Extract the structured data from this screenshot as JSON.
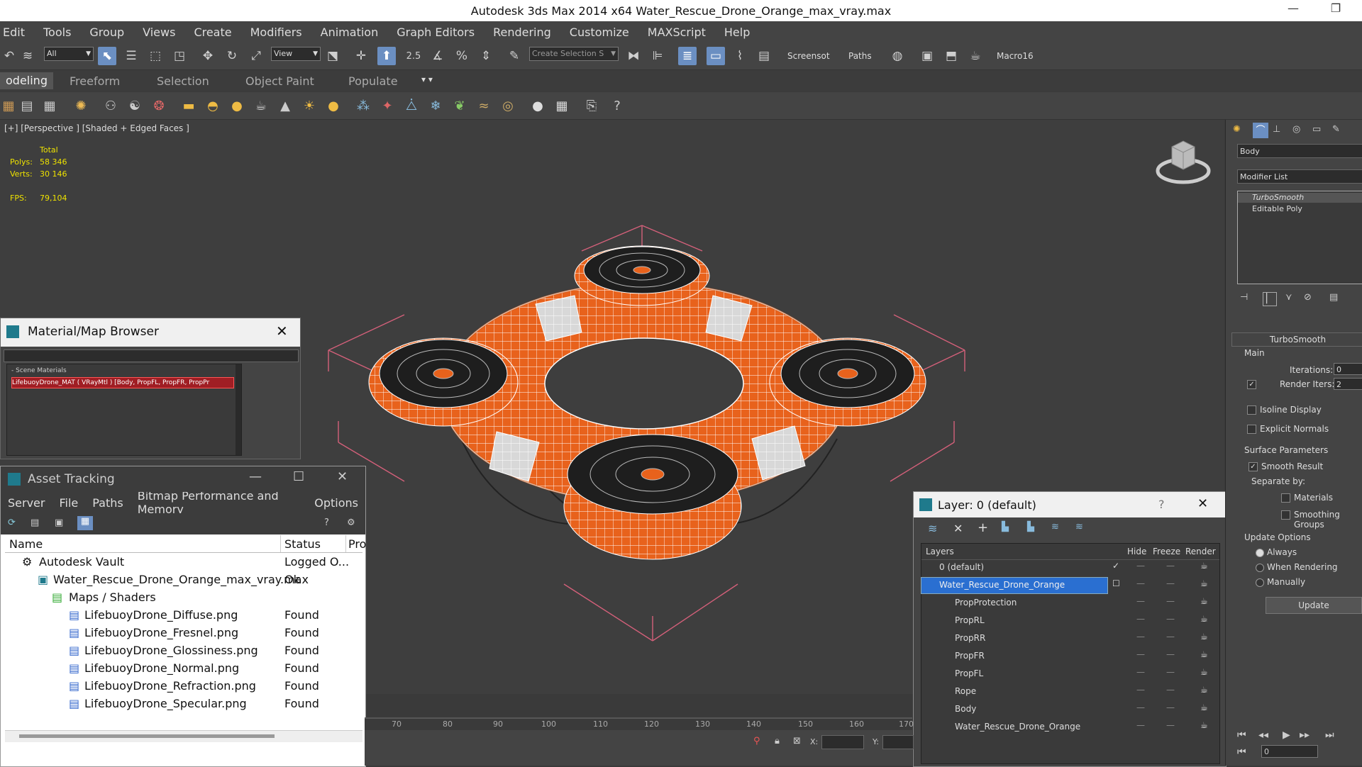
{
  "window": {
    "title": "Autodesk 3ds Max  2014 x64    Water_Rescue_Drone_Orange_max_vray.max"
  },
  "menu": [
    "Edit",
    "Tools",
    "Group",
    "Views",
    "Create",
    "Modifiers",
    "Animation",
    "Graph Editors",
    "Rendering",
    "Customize",
    "MAXScript",
    "Help"
  ],
  "toolbar": {
    "filter_value": "All",
    "coord_value": "View",
    "selection_set_placeholder": "Create Selection S",
    "screenshot_label": "Screensot",
    "paths_label": "Paths",
    "macro_label": "Macro16",
    "snap_angle_label": "2.5"
  },
  "ribbon": {
    "tabs": [
      "odeling",
      "Freeform",
      "Selection",
      "Object Paint",
      "Populate"
    ]
  },
  "viewport": {
    "label": "[+] [Perspective ] [Shaded + Edged Faces ]",
    "stats": {
      "total_label": "Total",
      "polys_label": "Polys:",
      "polys_value": "58 346",
      "verts_label": "Verts:",
      "verts_value": "30 146",
      "fps_label": "FPS:",
      "fps_value": "79,104"
    },
    "colors": {
      "drone_orange": "#e8621c",
      "bounding_box": "#d4607a",
      "selection_wire": "#ffffff"
    }
  },
  "material_browser": {
    "title": "Material/Map Browser",
    "section": "- Scene Materials",
    "item": "LifebuoyDrone_MAT ( VRayMtl ) [Body, PropFL, PropFR, PropPr"
  },
  "asset_tracking": {
    "title": "Asset Tracking",
    "menu": [
      "Server",
      "File",
      "Paths",
      "Bitmap Performance and Memory",
      "Options"
    ],
    "columns": [
      "Name",
      "Status",
      "Pro"
    ],
    "rows": [
      {
        "name": "Autodesk Vault",
        "status": "Logged O..."
      },
      {
        "name": "Water_Rescue_Drone_Orange_max_vray.max",
        "status": "Ok"
      },
      {
        "name": "Maps / Shaders",
        "status": ""
      },
      {
        "name": "LifebuoyDrone_Diffuse.png",
        "status": "Found"
      },
      {
        "name": "LifebuoyDrone_Fresnel.png",
        "status": "Found"
      },
      {
        "name": "LifebuoyDrone_Glossiness.png",
        "status": "Found"
      },
      {
        "name": "LifebuoyDrone_Normal.png",
        "status": "Found"
      },
      {
        "name": "LifebuoyDrone_Refraction.png",
        "status": "Found"
      },
      {
        "name": "LifebuoyDrone_Specular.png",
        "status": "Found"
      }
    ]
  },
  "layer_manager": {
    "title": "Layer: 0 (default)",
    "columns": [
      "Layers",
      "Hide",
      "Freeze",
      "Render"
    ],
    "rows": [
      "0 (default)",
      "Water_Rescue_Drone_Orange",
      "PropProtection",
      "PropRL",
      "PropRR",
      "PropFR",
      "PropFL",
      "Rope",
      "Body",
      "Water_Rescue_Drone_Orange"
    ]
  },
  "command_panel": {
    "object_name": "Body",
    "modifier_list_label": "Modifier List",
    "stack": [
      "TurboSmooth",
      "Editable Poly"
    ],
    "rollout_title": "TurboSmooth",
    "main_label": "Main",
    "iterations_label": "Iterations:",
    "iterations_value": "0",
    "render_iters_label": "Render Iters:",
    "render_iters_value": "2",
    "isoline_label": "Isoline Display",
    "explicit_label": "Explicit Normals",
    "surface_label": "Surface Parameters",
    "smooth_result_label": "Smooth Result",
    "separate_label": "Separate by:",
    "materials_label": "Materials",
    "smoothing_label": "Smoothing Groups",
    "update_options_label": "Update Options",
    "always_label": "Always",
    "when_rendering_label": "When Rendering",
    "manually_label": "Manually",
    "update_button": "Update"
  },
  "timeline": {
    "ticks": [
      "70",
      "80",
      "90",
      "100",
      "110",
      "120",
      "130",
      "140",
      "150",
      "160",
      "170"
    ]
  },
  "statusbar": {
    "x_label": "X:",
    "y_label": "Y:",
    "frame_value": "0"
  }
}
